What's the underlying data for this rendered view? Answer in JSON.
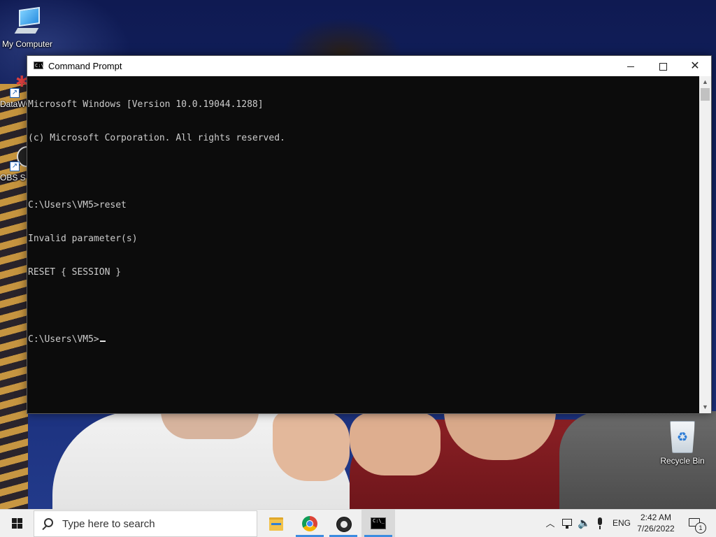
{
  "desktop": {
    "icons": [
      {
        "label": "My Computer",
        "icon": "computer-icon"
      },
      {
        "label": "DataWC",
        "icon": "datawc-shortcut-icon"
      },
      {
        "label": "OBS S",
        "icon": "obs-shortcut-icon"
      },
      {
        "label": "Recycle Bin",
        "icon": "recycle-bin-icon"
      }
    ]
  },
  "window": {
    "title": "Command Prompt",
    "icon": "cmd-app-icon",
    "controls": {
      "minimize": "minimize-icon",
      "maximize": "maximize-icon",
      "close": "close-icon"
    },
    "console_lines": [
      "Microsoft Windows [Version 10.0.19044.1288]",
      "(c) Microsoft Corporation. All rights reserved.",
      "",
      "C:\\Users\\VM5>reset",
      "Invalid parameter(s)",
      "RESET { SESSION }",
      "",
      "C:\\Users\\VM5>"
    ],
    "colors": {
      "background": "#0c0c0c",
      "text": "#cccccc"
    }
  },
  "taskbar": {
    "start_icon": "windows-logo-icon",
    "search_placeholder": "Type here to search",
    "apps": [
      {
        "name": "File Explorer",
        "icon": "file-explorer-icon",
        "active": false
      },
      {
        "name": "Google Chrome",
        "icon": "chrome-icon",
        "active": true
      },
      {
        "name": "OBS Studio",
        "icon": "obs-icon",
        "active": true
      },
      {
        "name": "Command Prompt",
        "icon": "cmd-icon",
        "active": true
      }
    ],
    "tray": {
      "language": "ENG",
      "time": "2:42 AM",
      "date": "7/26/2022",
      "notification_count": "1"
    }
  }
}
